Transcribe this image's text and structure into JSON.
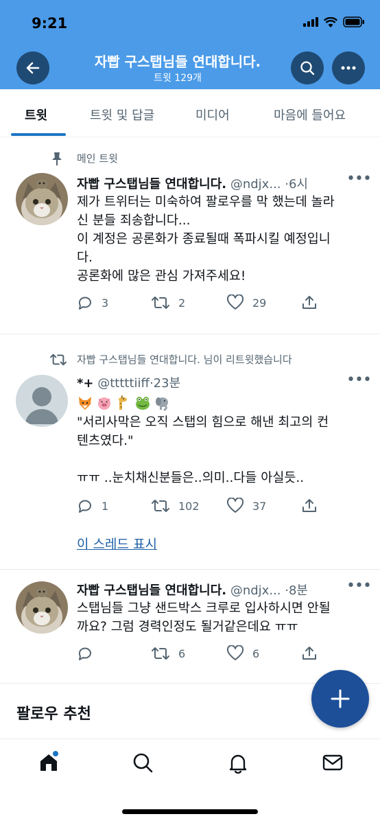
{
  "status_bar": {
    "time": "9:21"
  },
  "header": {
    "title": "자빱 구스탭님들 연대합니다.",
    "subtitle": "트윗 129개",
    "back_icon": "arrow-left-icon",
    "search_icon": "search-icon",
    "more_icon": "more-icon",
    "background_color": "#4b9be8"
  },
  "tabs": [
    {
      "label": "트윗",
      "active": true
    },
    {
      "label": "트윗 및 답글",
      "active": false
    },
    {
      "label": "미디어",
      "active": false
    },
    {
      "label": "마음에 들어요",
      "active": false
    }
  ],
  "tweets": [
    {
      "context": "메인 트윗",
      "context_icon": "pin-icon",
      "name": "자빱 구스탭님들 연대합니다.",
      "handle": "@ndjx...",
      "time": "6시",
      "text": "제가 트위터는 미숙하여 팔로우를 막 했는데 놀라\n신 분들 죄송합니다...\n이 계정은 공론화가 종료될때 폭파시킬 예정입니\n다.\n공론화에 많은 관심 가져주세요!",
      "replies": "3",
      "retweets": "2",
      "likes": "29",
      "avatar": "cat-avatar"
    },
    {
      "context": "자빱 구스탭님들 연대합니다. 님이 리트윗했습니다",
      "context_icon": "retweet-icon",
      "name": "*+",
      "handle": "@tttttiiff",
      "time": "23분",
      "emojis": [
        "fox-emoji",
        "pig-emoji",
        "giraffe-emoji",
        "frog-emoji",
        "elephant-emoji"
      ],
      "text": "\"서리사막은 오직 스탭의 힘으로 해낸 최고의 컨\n텐츠였다.\"\n\nㅠㅠ ..눈치채신분들은..의미..다들 아실듯..",
      "replies": "1",
      "retweets": "102",
      "likes": "37",
      "thread_link": "이 스레드 표시",
      "avatar": "default-avatar"
    },
    {
      "name": "자빱 구스탭님들 연대합니다.",
      "handle": "@ndjx...",
      "time": "8분",
      "text": "스탭님들 그냥 샌드박스 크루로 입사하시면 안될\n까요? 그럼 경력인정도 될거같은데요 ㅠㅠ",
      "replies": "",
      "retweets": "6",
      "likes": "6",
      "avatar": "cat-avatar"
    }
  ],
  "follow_suggestions": {
    "title": "팔로우 추천"
  },
  "fab": {
    "icon": "plus-icon",
    "color": "#1d4f99"
  },
  "bottom_nav": [
    "home-icon",
    "search-icon",
    "notifications-icon",
    "messages-icon"
  ],
  "colors": {
    "accent": "#1d75c4",
    "link": "#1d5fa6",
    "muted": "#536471"
  }
}
